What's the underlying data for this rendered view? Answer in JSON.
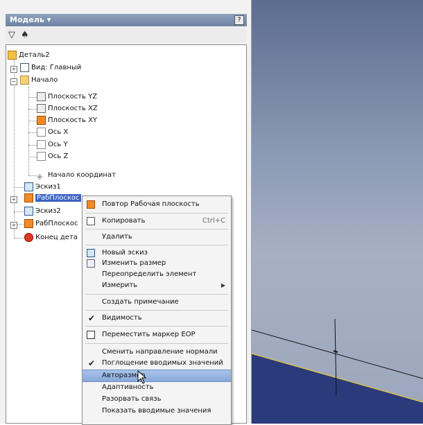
{
  "panel": {
    "title": "Модель ▾",
    "help": "?",
    "filter_icon": "filter-icon",
    "find_icon": "binoculars-icon"
  },
  "tree": {
    "part": "Деталь2",
    "view": "Вид: Главный",
    "origin_folder": "Начало",
    "plane_yz": "Плоскость YZ",
    "plane_xz": "Плоскость XZ",
    "plane_xy": "Плоскость XY",
    "axis_x": "Ось X",
    "axis_y": "Ось Y",
    "axis_z": "Ось Z",
    "origin_point": "Начало координат",
    "sketch1": "Эскиз1",
    "workplane1": "РабПлоскос",
    "sketch2": "Эскиз2",
    "workplane2": "РабПлоскос",
    "end_of_part": "Конец дета"
  },
  "menu": {
    "repeat": "Повтор Рабочая плоскость",
    "copy": "Копировать",
    "copy_shortcut": "Ctrl+C",
    "delete": "Удалить",
    "new_sketch": "Новый эскиз",
    "resize": "Изменить размер",
    "redefine": "Переопределить элемент",
    "measure": "Измерить",
    "create_note": "Создать примечание",
    "visibility": "Видимость",
    "move_eop": "Переместить маркер EOP",
    "flip_normal": "Сменить направление нормали",
    "consume_inputs": "Поглощение вводимых значений",
    "autoresize": "Авторазмер",
    "adaptive": "Адаптивность",
    "break_link": "Разорвать связь",
    "show_inputs": "Показать вводимые значения"
  },
  "colors": {
    "selection": "#3a62c4",
    "menu_highlight": "#9bb7e3",
    "viewport_top": "#5d6d8f",
    "plane_fill": "#2a3a7a"
  }
}
